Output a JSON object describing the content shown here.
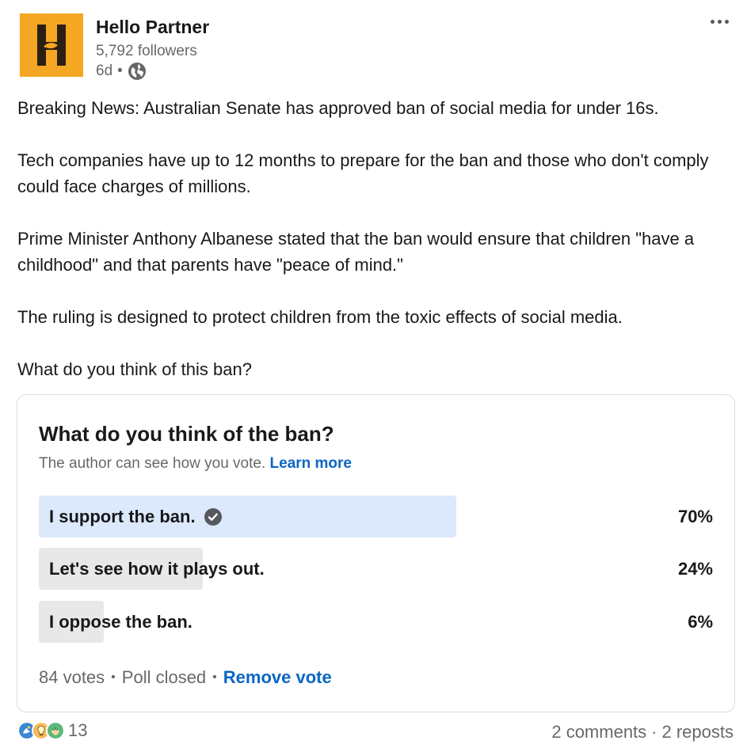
{
  "author": {
    "name": "Hello Partner",
    "followers": "5,792 followers",
    "time": "6d",
    "dot": "•",
    "visibility_icon": "globe-icon",
    "brand_color": "#f5a623"
  },
  "menu_icon": "ellipsis-icon",
  "post": {
    "paragraphs": [
      "Breaking News: Australian Senate has approved ban of social media for under 16s.",
      "Tech companies have up to 12 months to prepare for the ban and those who don't comply could face charges of millions.",
      "Prime Minister Anthony Albanese stated that the ban would ensure that children \"have a childhood\" and that parents have \"peace of mind.\"",
      "The ruling is designed to protect children from the toxic effects of social media.",
      "What do you think of this ban?"
    ]
  },
  "poll": {
    "question": "What do you think of the ban?",
    "note": "The author can see how you vote.",
    "learn_more": "Learn more",
    "options": [
      {
        "label": "I support the ban.",
        "percent": "70%",
        "fraction": 0.7,
        "selected": true,
        "bar_color": "#dce9fc"
      },
      {
        "label": "Let's see how it plays out.",
        "percent": "24%",
        "fraction": 0.24,
        "selected": false,
        "bar_color": "#e8e8e8"
      },
      {
        "label": "I oppose the ban.",
        "percent": "6%",
        "fraction": 0.06,
        "selected": false,
        "bar_color": "#e8e8e8"
      }
    ],
    "votes": "84 votes",
    "status": "Poll closed",
    "remove_vote": "Remove vote",
    "sep": "•"
  },
  "social": {
    "reaction_icons": [
      "celebrate-icon",
      "insightful-icon",
      "support-icon"
    ],
    "reaction_count": "13",
    "comments": "2 comments",
    "sep": "·",
    "reposts": "2 reposts"
  },
  "colors": {
    "link": "#0a66c2",
    "selected_bar": "#dce9fc",
    "result_bar": "#e8e8e8"
  }
}
